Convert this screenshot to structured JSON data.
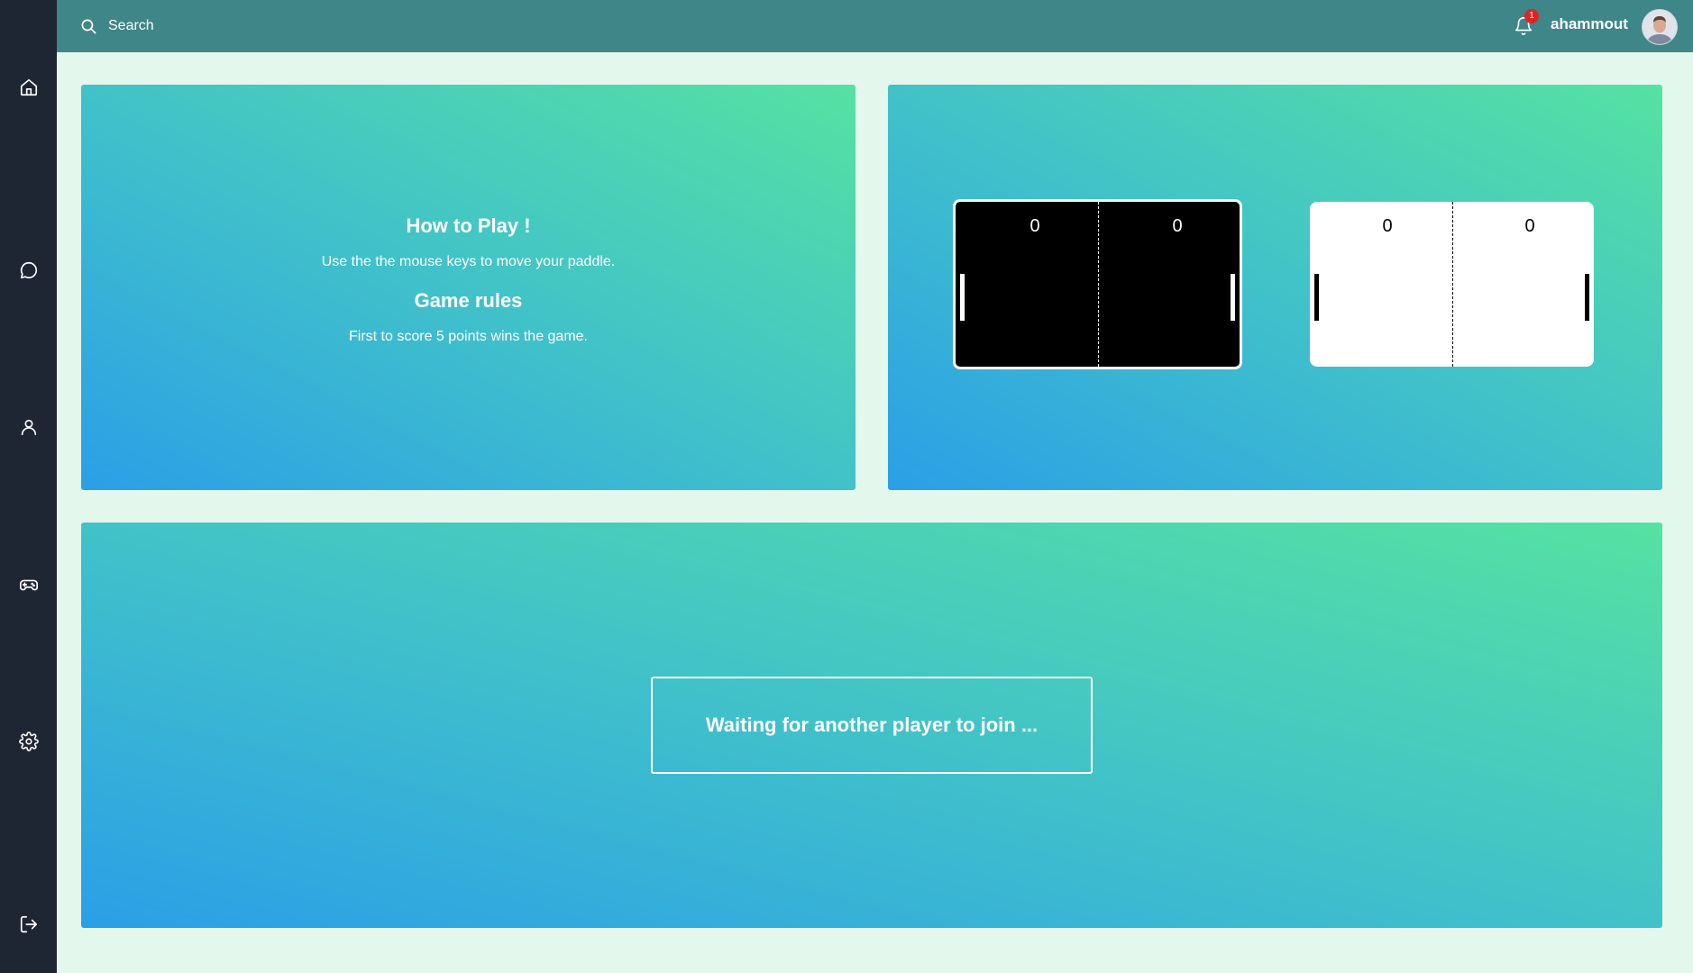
{
  "sidebar": {
    "items": [
      {
        "name": "home",
        "icon": "home-icon"
      },
      {
        "name": "chat",
        "icon": "chat-bubble-icon"
      },
      {
        "name": "profile",
        "icon": "user-icon"
      },
      {
        "name": "game",
        "icon": "gamepad-icon"
      },
      {
        "name": "settings",
        "icon": "gear-icon"
      }
    ],
    "logout_icon": "logout-icon"
  },
  "header": {
    "search_placeholder": "Search",
    "notification_count": "1",
    "username": "ahammout"
  },
  "how_to_play": {
    "title": "How to Play !",
    "instructions": "Use the the mouse keys to move your paddle.",
    "rules_title": "Game rules",
    "rules_text": "First to score 5 points wins the game."
  },
  "themes": [
    {
      "name": "dark",
      "left_score": "0",
      "right_score": "0",
      "background": "#000000",
      "foreground": "#ffffff",
      "selected": true
    },
    {
      "name": "light",
      "left_score": "0",
      "right_score": "0",
      "background": "#ffffff",
      "foreground": "#000000",
      "selected": false
    }
  ],
  "waiting_message": "Waiting for another player to join ...",
  "colors": {
    "sidebar": "#1e2533",
    "topbar": "#3e8687",
    "page_background": "#e4f7ec",
    "gradient_start": "#2b9fe6",
    "gradient_end": "#55e2a2",
    "badge": "#e02424"
  }
}
